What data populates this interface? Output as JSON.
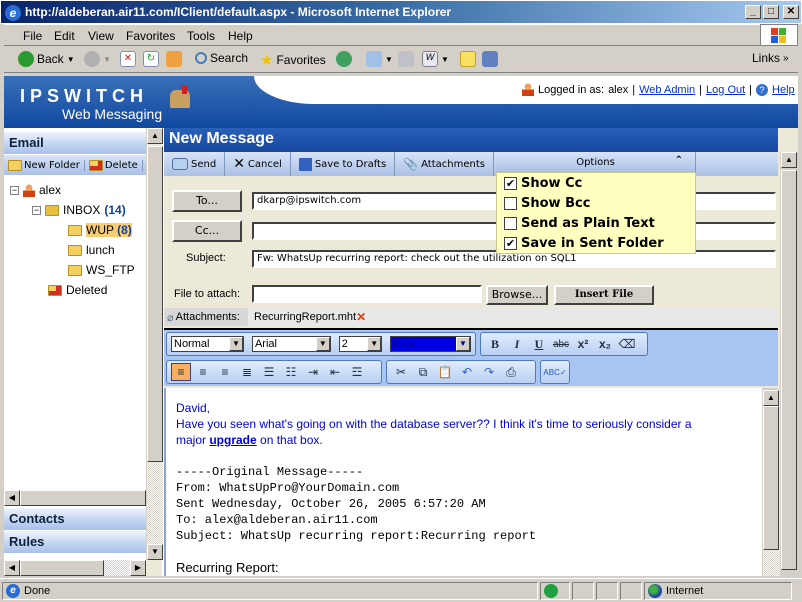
{
  "window": {
    "title": "http://aldeberan.air11.com/IClient/default.aspx - Microsoft Internet Explorer",
    "minimize": "_",
    "maximize": "□",
    "close": "✕"
  },
  "menu": [
    "File",
    "Edit",
    "View",
    "Favorites",
    "Tools",
    "Help"
  ],
  "toolbar": {
    "back": "Back",
    "search": "Search",
    "favorites": "Favorites",
    "links": "Links",
    "links_more": "»"
  },
  "banner": {
    "logo_top": "IPSWITCH",
    "logo_bottom": "Web Messaging",
    "logged_in_label": "Logged in as:",
    "user": "alex",
    "web_admin": "Web Admin",
    "log_out": "Log Out",
    "help": "Help",
    "sep": "|"
  },
  "left": {
    "email_header": "Email",
    "new_folder": "New Folder",
    "delete": "Delete",
    "tree": {
      "user": "alex",
      "inbox": "INBOX",
      "inbox_count": "(14)",
      "wup": "WUP",
      "wup_count": "(8)",
      "lunch": "lunch",
      "ws_ftp": "WS_FTP",
      "deleted": "Deleted"
    },
    "contacts": "Contacts",
    "rules": "Rules"
  },
  "compose": {
    "title": "New Message",
    "actions": {
      "send": "Send",
      "cancel": "Cancel",
      "save_drafts": "Save to Drafts",
      "attachments": "Attachments"
    },
    "options": {
      "header": "Options",
      "collapse": "⌃",
      "items": [
        {
          "label": "Show Cc",
          "checked": "✔"
        },
        {
          "label": "Show Bcc",
          "checked": ""
        },
        {
          "label": "Send as Plain Text",
          "checked": ""
        },
        {
          "label": "Save in Sent Folder",
          "checked": "✔"
        }
      ]
    },
    "to_button": "To...",
    "to_value": "dkarp@ipswitch.com",
    "cc_button": "Cc...",
    "cc_value": "",
    "subject_label": "Subject:",
    "subject_value": "Fw: WhatsUp recurring report: check out the utilization on SQL1",
    "file_label": "File to attach:",
    "file_value": "",
    "browse": "Browse...",
    "insert_file": "Insert File",
    "attachments_label": "Attachments:",
    "attachment_file": "RecurringReport.mht"
  },
  "editor_toolbar": {
    "style": "Normal",
    "font": "Arial",
    "size": "2",
    "color": "Blue",
    "bold": "B",
    "italic": "I",
    "underline": "U",
    "strike": "abc",
    "superscript": "x²",
    "subscript": "x₂",
    "spell": "ABC✓"
  },
  "body": {
    "greeting": "David,",
    "line1": "Have you seen what's going on with the database server??  I think it's time to seriously consider a",
    "line2_pre": "major ",
    "line2_link": "upgrade",
    "line2_post": " on that box.",
    "orig_header": "-----Original Message-----",
    "from": "From: WhatsUpPro@YourDomain.com",
    "sent": "Sent Wednesday, October 26, 2005 6:57:20 AM",
    "to": "To: alex@aldeberan.air11.com",
    "subject": "Subject: WhatsUp recurring report:Recurring report",
    "partial": "Recurring Report:"
  },
  "status": {
    "text": "Done",
    "zone": "Internet"
  }
}
